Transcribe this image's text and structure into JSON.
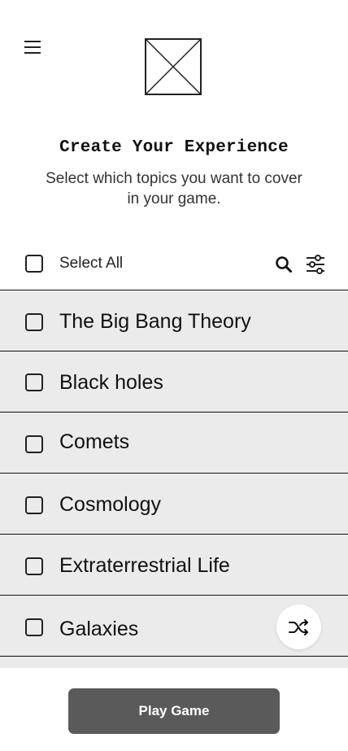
{
  "header": {
    "menu_icon": "hamburger-menu-icon",
    "logo_icon": "image-placeholder-icon",
    "title": "Create Your Experience",
    "subtitle": "Select which topics you want to cover in your game."
  },
  "toolbar": {
    "select_all_label": "Select All",
    "search_icon": "search-icon",
    "filter_icon": "sliders-icon"
  },
  "topics": [
    {
      "label": "The Big Bang Theory",
      "checked": false
    },
    {
      "label": "Black holes",
      "checked": false
    },
    {
      "label": "Comets",
      "checked": false
    },
    {
      "label": "Cosmology",
      "checked": false
    },
    {
      "label": "Extraterrestrial Life",
      "checked": false
    },
    {
      "label": "Galaxies",
      "checked": false
    }
  ],
  "fab": {
    "icon": "shuffle-icon"
  },
  "footer": {
    "play_label": "Play Game"
  },
  "colors": {
    "list_background": "#ebebeb",
    "button_background": "#5a5a5a",
    "divider": "#111111"
  }
}
